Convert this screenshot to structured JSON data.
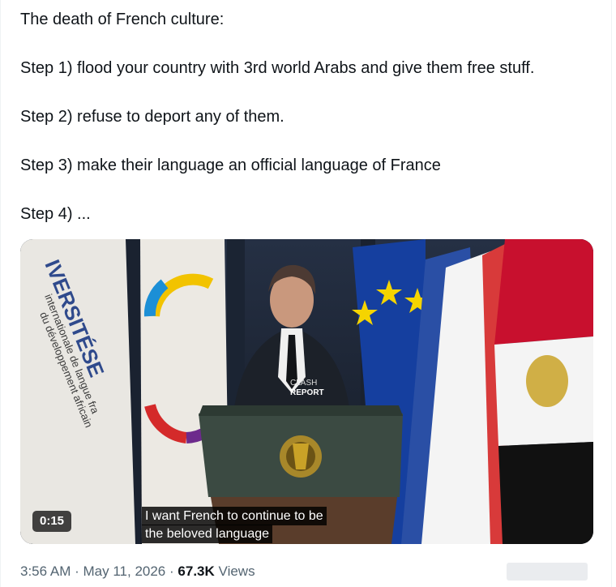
{
  "tweet": {
    "lines": [
      "The death of French culture:",
      "Step 1) flood your country with 3rd world Arabs  and give them free stuff.",
      "Step 2) refuse to deport any of them.",
      "Step 3) make their language an official language of France",
      "Step 4) ..."
    ]
  },
  "video": {
    "duration": "0:15",
    "caption_line1": "I want French to continue to be",
    "caption_line2": "the beloved language",
    "overlay_logo_top": "CLASH",
    "overlay_logo_bottom": "REPORT",
    "banner_text_main": "IVERSITÉSE",
    "banner_text_line2": "internationale de langue fra",
    "banner_text_line3": "du développement africain"
  },
  "meta": {
    "time": "3:56 AM",
    "separator": "·",
    "date": "May 11, 2026",
    "views_count": "67.3K",
    "views_label": "Views"
  }
}
